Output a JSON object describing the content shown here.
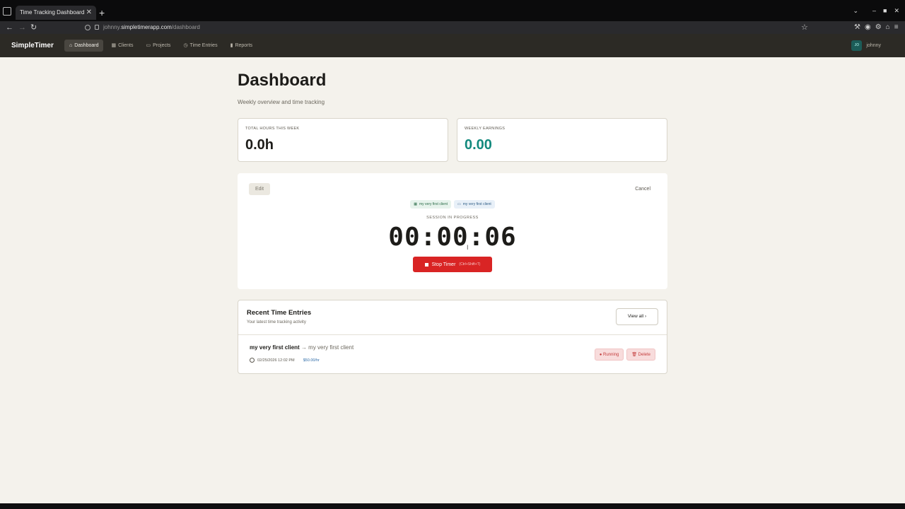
{
  "browser": {
    "tab_title": "Time Tracking Dashboard",
    "url_prefix": "johnny.",
    "url_host": "simpletimerapp.com",
    "url_path": "/dashboard"
  },
  "nav": {
    "brand": "SimpleTimer",
    "items": [
      {
        "label": "Dashboard",
        "icon": "home-icon"
      },
      {
        "label": "Clients",
        "icon": "building-icon"
      },
      {
        "label": "Projects",
        "icon": "briefcase-icon"
      },
      {
        "label": "Time Entries",
        "icon": "clock-icon"
      },
      {
        "label": "Reports",
        "icon": "bar-chart-icon"
      }
    ],
    "user_initials": "JO",
    "user_name": "johnny"
  },
  "page": {
    "title": "Dashboard",
    "subtitle": "Weekly overview and time tracking"
  },
  "stats": {
    "hours_label": "TOTAL HOURS THIS WEEK",
    "hours_value": "0.0h",
    "earnings_label": "WEEKLY EARNINGS",
    "earnings_value": "0.00"
  },
  "timer": {
    "edit_label": "Edit",
    "cancel_label": "Cancel",
    "client_chip": "my very first client",
    "project_chip": "my very first client",
    "session_label": "SESSION IN PROGRESS",
    "elapsed": "00:00:06",
    "stop_label": "Stop Timer",
    "stop_shortcut": "(Ctrl+Shift+T)"
  },
  "recent": {
    "title": "Recent Time Entries",
    "subtitle": "Your latest time tracking activity",
    "view_all_label": "View all",
    "entries": [
      {
        "client": "my very first client",
        "arrow": "→",
        "project": "my very first client",
        "datetime": "02/25/2026 12:02 PM",
        "rate": "$50.00/hr",
        "status": "Running",
        "delete_label": "Delete"
      }
    ]
  }
}
